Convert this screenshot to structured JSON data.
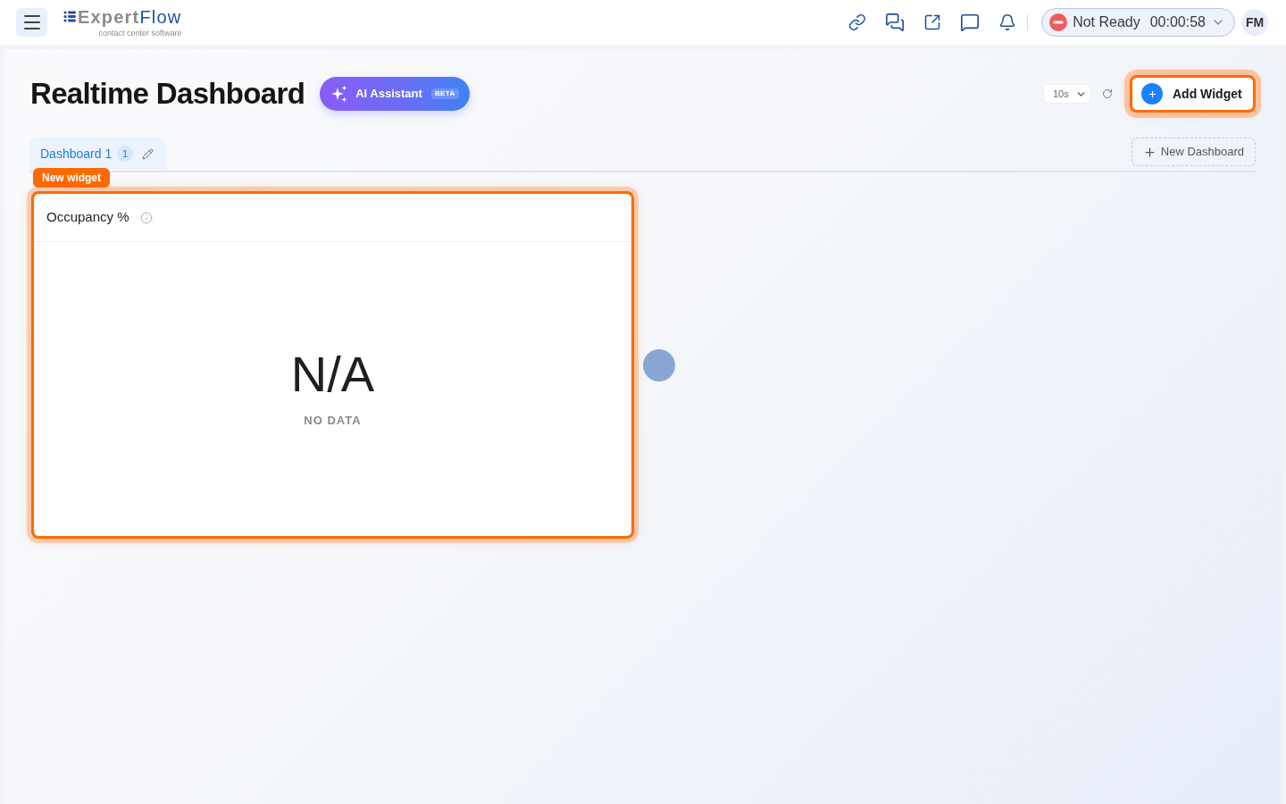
{
  "header": {
    "logo": {
      "word_1": "Expert",
      "word_2": "Flow",
      "tagline": "contact center software"
    },
    "agent_status": {
      "label": "Not Ready",
      "timer": "00:00:58"
    },
    "avatar": "FM"
  },
  "page": {
    "title": "Realtime Dashboard",
    "ai_assistant": {
      "label": "AI Assistant",
      "badge": "BETA"
    },
    "refresh_interval": "10s",
    "add_widget": {
      "label": "Add Widget",
      "highlighted": true
    }
  },
  "dashboards": [
    {
      "label": "Dashboard 1",
      "count": "1",
      "selected": true
    }
  ],
  "new_dashboard": "New Dashboard",
  "widgets": [
    {
      "tag": "New widget",
      "title": "Occupancy %",
      "value": "N/A",
      "caption": "NO DATA",
      "highlighted": true
    }
  ]
}
